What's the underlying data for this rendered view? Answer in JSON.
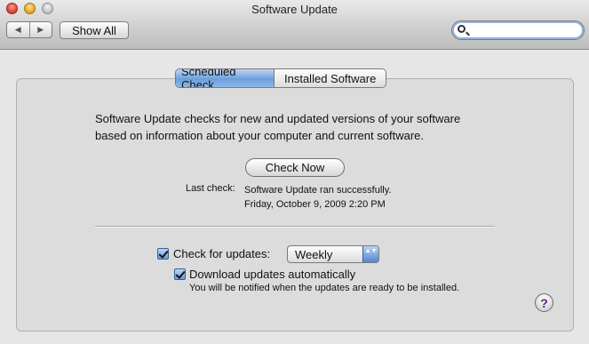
{
  "window": {
    "title": "Software Update",
    "close_glyph": "●",
    "minimize_glyph": "●",
    "zoom_glyph": "●"
  },
  "toolbar": {
    "back_glyph": "◀",
    "forward_glyph": "▶",
    "show_all_label": "Show All",
    "search": {
      "value": "",
      "placeholder": ""
    }
  },
  "tabs": [
    {
      "label": "Scheduled Check",
      "active": true
    },
    {
      "label": "Installed Software",
      "active": false
    }
  ],
  "description": {
    "line1": "Software Update checks for new and updated versions of your software",
    "line2": "based on information about your computer and current software."
  },
  "check_now_label": "Check Now",
  "last_check": {
    "label": "Last check:",
    "status": "Software Update ran successfully.",
    "timestamp": "Friday, October 9, 2009 2:20 PM"
  },
  "options": {
    "check_for_updates": {
      "label": "Check for updates:",
      "checked": true
    },
    "frequency": {
      "selected": "Weekly",
      "arrows": "▲▼"
    },
    "download_automatically": {
      "label": "Download updates automatically",
      "checked": true,
      "note": "You will be notified when the updates are ready to be installed."
    }
  },
  "help_label": "?",
  "colors": {
    "accent": "#6d9fdc",
    "help_glyph": "#5b1c7f"
  }
}
